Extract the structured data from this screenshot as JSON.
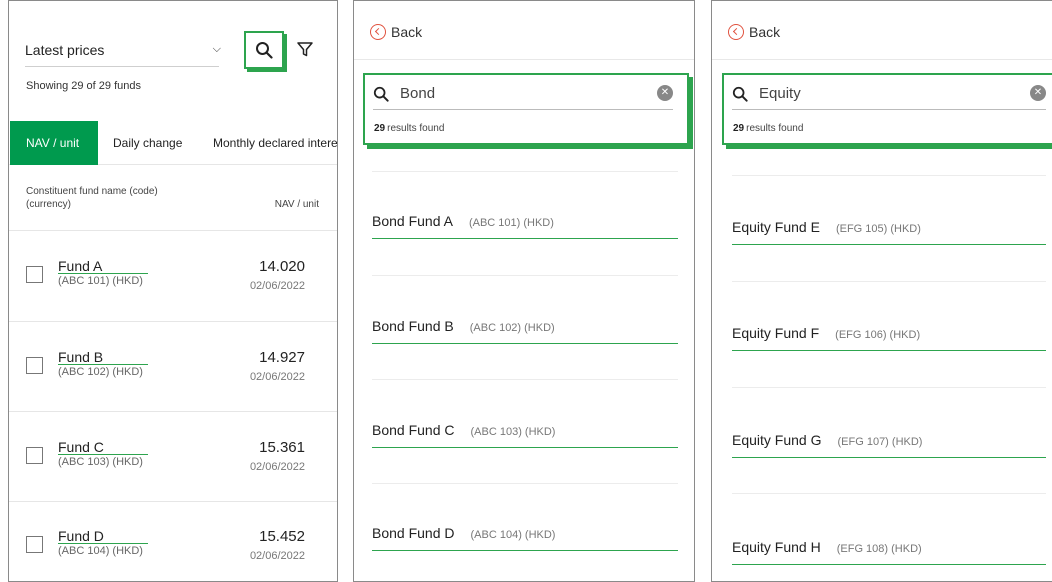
{
  "panel1": {
    "dropdown": {
      "label": "Latest prices"
    },
    "showing": "Showing 29 of 29 funds",
    "tabs": [
      {
        "label": "NAV / unit",
        "active": true
      },
      {
        "label": "Daily change",
        "active": false
      },
      {
        "label": "Monthly declared interest",
        "active": false
      }
    ],
    "column_header": {
      "left": "Constituent fund name (code) (currency)",
      "right": "NAV / unit"
    },
    "funds": [
      {
        "name": "Fund A",
        "code": "(ABC 101) (HKD)",
        "nav": "14.020",
        "date": "02/06/2022"
      },
      {
        "name": "Fund B",
        "code": "(ABC 102) (HKD)",
        "nav": "14.927",
        "date": "02/06/2022"
      },
      {
        "name": "Fund C",
        "code": "(ABC 103) (HKD)",
        "nav": "15.361",
        "date": "02/06/2022"
      },
      {
        "name": "Fund D",
        "code": "(ABC 104) (HKD)",
        "nav": "15.452",
        "date": "02/06/2022"
      }
    ]
  },
  "panel2": {
    "back_label": "Back",
    "search": {
      "query": "Bond",
      "count": "29",
      "count_suffix": "results found"
    },
    "results": [
      {
        "name": "Bond Fund A",
        "code": "(ABC 101) (HKD)"
      },
      {
        "name": "Bond Fund B",
        "code": "(ABC 102) (HKD)"
      },
      {
        "name": "Bond Fund C",
        "code": "(ABC 103) (HKD)"
      },
      {
        "name": "Bond Fund D",
        "code": "(ABC 104) (HKD)"
      }
    ]
  },
  "panel3": {
    "back_label": "Back",
    "search": {
      "query": "Equity",
      "count": "29",
      "count_suffix": "results found"
    },
    "results": [
      {
        "name": "Equity Fund E",
        "code": "(EFG 105) (HKD)"
      },
      {
        "name": "Equity Fund F",
        "code": "(EFG 106) (HKD)"
      },
      {
        "name": "Equity Fund G",
        "code": "(EFG 107) (HKD)"
      },
      {
        "name": "Equity Fund H",
        "code": "(EFG 108) (HKD)"
      }
    ]
  },
  "colors": {
    "accent": "#009a4e",
    "outline": "#2da44e",
    "back_icon": "#e0523f"
  },
  "icons": {
    "search": "search-icon",
    "filter": "filter-icon",
    "clear": "clear-icon",
    "back": "back-circle-icon",
    "chevron": "chevron-down-icon"
  }
}
